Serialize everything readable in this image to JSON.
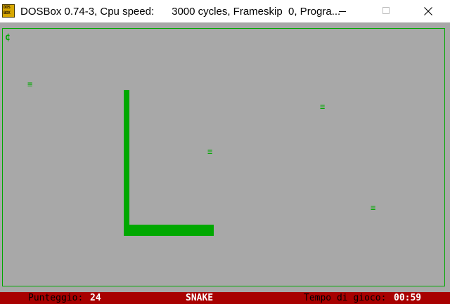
{
  "window": {
    "title": "DOSBox 0.74-3, Cpu speed:      3000 cycles, Frameskip  0, Progra...",
    "icon_text_top": "DOS",
    "icon_text_bottom": "BOX",
    "buttons": [
      "minimize-icon",
      "maximize-icon",
      "close-icon"
    ]
  },
  "game": {
    "cursor_char": "¢",
    "food_glyph": "≡",
    "food_items": [
      {
        "glyph": "≡"
      },
      {
        "glyph": "≡"
      },
      {
        "glyph": "≡"
      },
      {
        "glyph": "≡"
      }
    ]
  },
  "status": {
    "score_label": "Punteggio:",
    "score_value": "24",
    "game_title": "SNAKE",
    "time_label": "Tempo di gioco:",
    "time_value": "00:59"
  },
  "colors": {
    "background": "#a8a8a8",
    "snake": "#00a800",
    "border": "#00a800",
    "statusbar": "#a80000"
  }
}
